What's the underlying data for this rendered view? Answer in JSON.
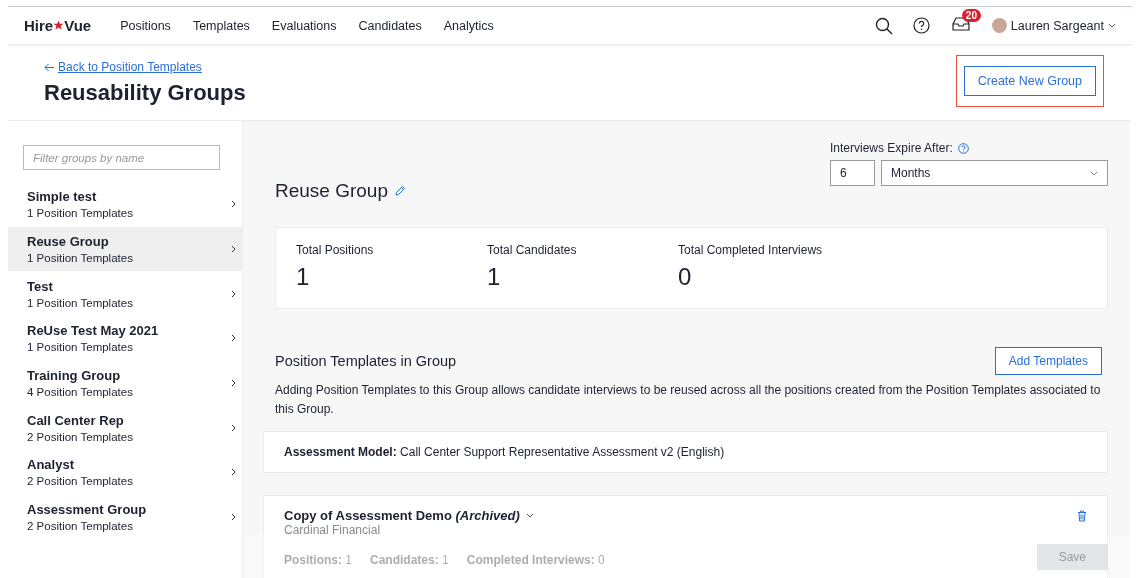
{
  "topbar": {
    "logo": {
      "left": "Hire",
      "right": "Vue"
    },
    "nav": [
      {
        "label": "Positions",
        "selected": false
      },
      {
        "label": "Templates",
        "selected": false
      },
      {
        "label": "Evaluations",
        "selected": false
      },
      {
        "label": "Candidates",
        "selected": false
      },
      {
        "label": "Analytics",
        "selected": false
      }
    ],
    "notifications_badge": "20",
    "user": "Lauren Sargeant"
  },
  "header": {
    "back_link": "Back to Position Templates",
    "title": "Reusability Groups",
    "create_button": {
      "label": "Create New Group",
      "highlighted": true
    }
  },
  "sidebar": {
    "filter": {
      "placeholder": "Filter groups by name"
    },
    "groups": [
      {
        "name": "Simple test",
        "count": "1 Position Templates",
        "selected": false
      },
      {
        "name": "Reuse Group",
        "count": "1 Position Templates",
        "selected": true
      },
      {
        "name": "Test",
        "count": "1 Position Templates",
        "selected": false
      },
      {
        "name": "ReUse Test May 2021",
        "count": "1 Position Templates",
        "selected": false
      },
      {
        "name": "Training Group",
        "count": "4 Position Templates",
        "selected": false
      },
      {
        "name": "Call Center Rep",
        "count": "2 Position Templates",
        "selected": false
      },
      {
        "name": "Analyst",
        "count": "2 Position Templates",
        "selected": false
      },
      {
        "name": "Assessment Group",
        "count": "2 Position Templates",
        "selected": false
      }
    ]
  },
  "detail": {
    "title": "Reuse Group",
    "expire": {
      "label": "Interviews Expire After:",
      "value": "6",
      "unit": "Months"
    },
    "stats": [
      {
        "label": "Total Positions",
        "value": "1"
      },
      {
        "label": "Total Candidates",
        "value": "1"
      },
      {
        "label": "Total Completed Interviews",
        "value": "0"
      }
    ],
    "templates": {
      "title": "Position Templates in Group",
      "add_button": "Add Templates",
      "description": "Adding Position Templates to this Group allows candidate interviews to be reused across all the positions created from the Position Templates associated to this Group.",
      "assessment": "**Assessment Model:** Call Center Support Representative Assessment v2 (English)",
      "items": [
        {
          "name": "Copy of Assessment Demo *(Archived)*",
          "company": "Cardinal Financial",
          "metrics": [
            "**Positions:** 1",
            "**Candidates:** 1",
            "**Completed Interviews:** 0"
          ]
        }
      ]
    },
    "save_button": {
      "label": "Save",
      "disabled": true
    }
  }
}
